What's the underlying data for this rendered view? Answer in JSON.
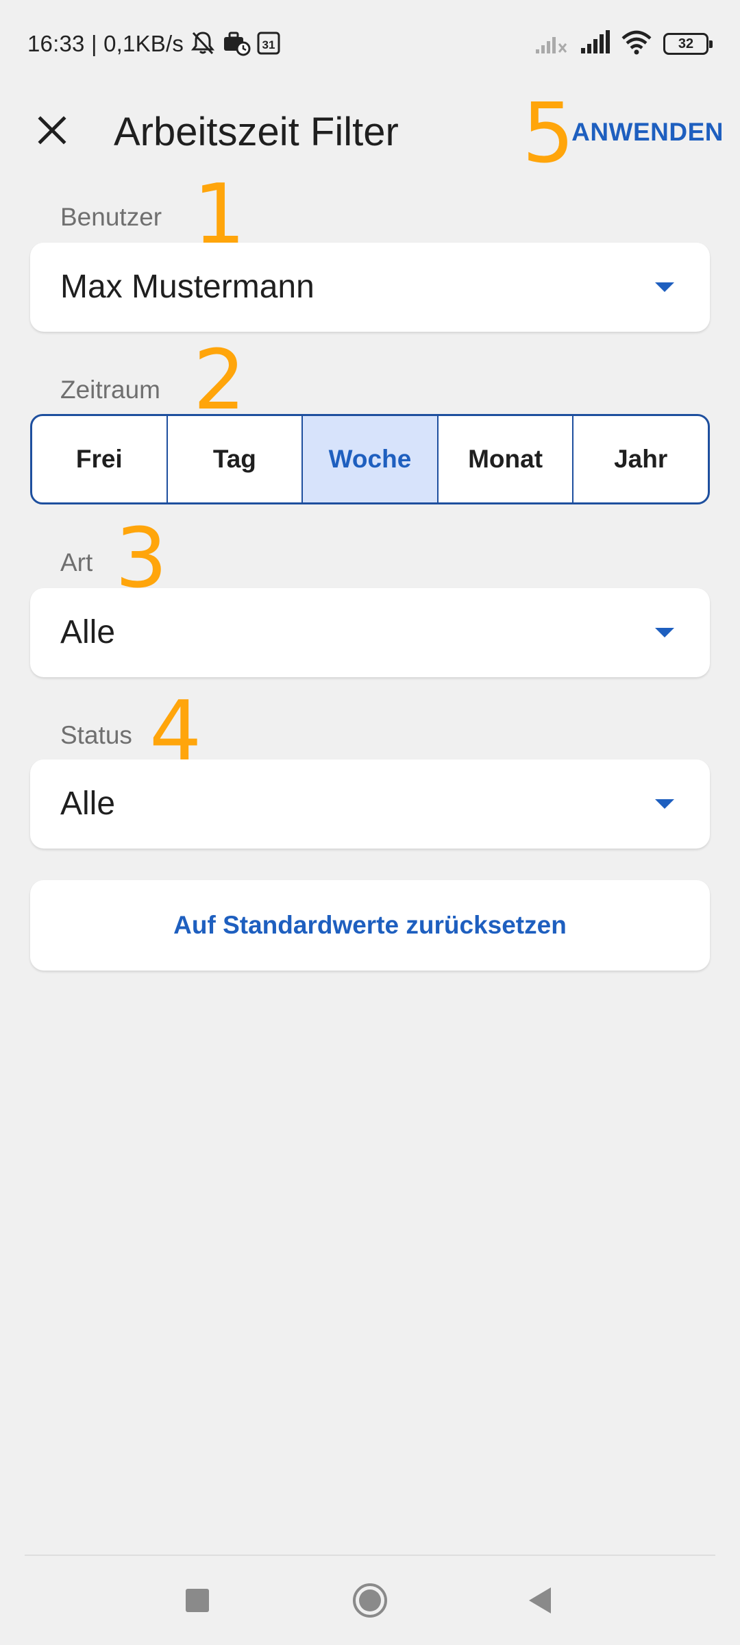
{
  "status_bar": {
    "time_speed": "16:33 | 0,1KB/s",
    "calendar_day": "31",
    "battery_level": "32",
    "icons": [
      "mute-icon",
      "briefcase-clock-icon",
      "calendar-icon",
      "signal-off-icon",
      "signal-icon",
      "wifi-icon",
      "battery-icon"
    ]
  },
  "header": {
    "close_icon": "close-icon",
    "title": "Arbeitszeit Filter",
    "apply_label": "ANWENDEN"
  },
  "annotations": [
    "1",
    "2",
    "3",
    "4",
    "5"
  ],
  "fields": {
    "user": {
      "label": "Benutzer",
      "value": "Max Mustermann"
    },
    "period": {
      "label": "Zeitraum",
      "options": [
        "Frei",
        "Tag",
        "Woche",
        "Monat",
        "Jahr"
      ],
      "selected": "Woche"
    },
    "type": {
      "label": "Art",
      "value": "Alle"
    },
    "status": {
      "label": "Status",
      "value": "Alle"
    }
  },
  "reset_label": "Auf Standardwerte zurücksetzen",
  "nav": {
    "icons": [
      "recents-icon",
      "home-icon",
      "back-icon"
    ]
  },
  "colors": {
    "accent": "#1e5fbf",
    "annotation": "#ffa50b",
    "background": "#f0f0f0",
    "segment_selected_bg": "#d7e3fb"
  }
}
